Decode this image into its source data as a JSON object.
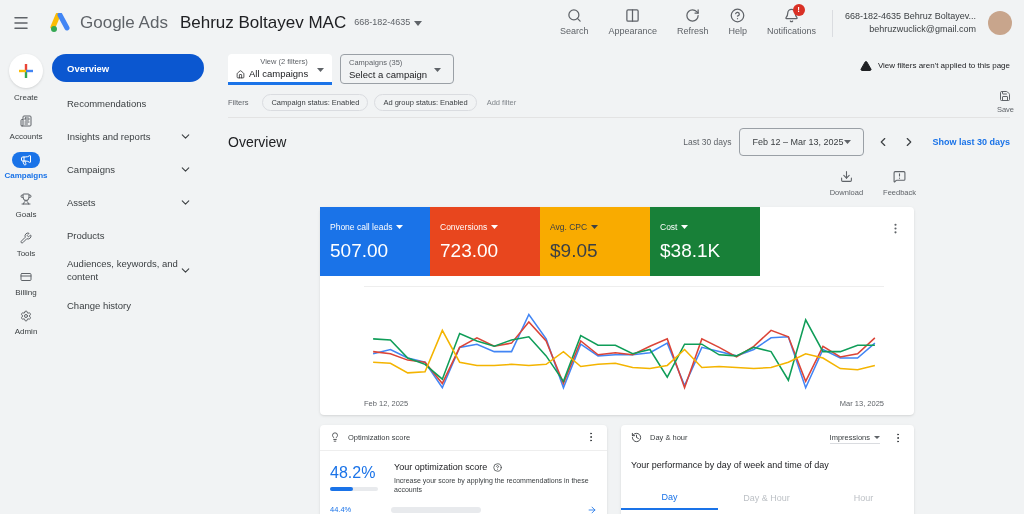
{
  "header": {
    "app_name": "Google Ads",
    "account": "Behruz Boltayev MAC",
    "account_id": "668-182-4635",
    "tools": [
      {
        "kind": "search",
        "label": "Search"
      },
      {
        "kind": "appearance",
        "label": "Appearance"
      },
      {
        "kind": "refresh",
        "label": "Refresh"
      },
      {
        "kind": "help",
        "label": "Help"
      },
      {
        "kind": "notifications",
        "label": "Notifications",
        "badge": "!"
      }
    ],
    "user_line": "668-182-4635 Behruz Boltayev...",
    "email": "behruzwuclick@gmail.com"
  },
  "rail": {
    "create": "Create",
    "items": [
      {
        "kind": "accounts",
        "label": "Accounts",
        "selected": false
      },
      {
        "kind": "campaigns",
        "label": "Campaigns",
        "selected": true
      },
      {
        "kind": "goals",
        "label": "Goals",
        "selected": false
      },
      {
        "kind": "tools",
        "label": "Tools",
        "selected": false
      },
      {
        "kind": "billing",
        "label": "Billing",
        "selected": false
      },
      {
        "kind": "admin",
        "label": "Admin",
        "selected": false
      }
    ]
  },
  "nav": [
    {
      "label": "Overview",
      "selected": true,
      "expandable": false
    },
    {
      "label": "Recommendations",
      "selected": false,
      "expandable": false
    },
    {
      "label": "Insights and reports",
      "selected": false,
      "expandable": true
    },
    {
      "label": "Campaigns",
      "selected": false,
      "expandable": true
    },
    {
      "label": "Assets",
      "selected": false,
      "expandable": true
    },
    {
      "label": "Products",
      "selected": false,
      "expandable": false
    },
    {
      "label": "Audiences, keywords, and content",
      "selected": false,
      "expandable": true
    },
    {
      "label": "Change history",
      "selected": false,
      "expandable": false
    }
  ],
  "view_select": {
    "caption": "View (2 filters)",
    "value": "All campaigns"
  },
  "campaign_select": {
    "caption": "Campaigns (35)",
    "value": "Select a campaign"
  },
  "filters": {
    "label": "Filters",
    "chips": [
      "Campaign status: Enabled",
      "Ad group status: Enabled"
    ],
    "add": "Add filter"
  },
  "warning": "View filters aren't applied to this page",
  "save": "Save",
  "overview": {
    "title": "Overview",
    "range_label": "Last 30 days",
    "date_range": "Feb 12 – Mar 13, 2025",
    "show_last": "Show last 30 days",
    "actions": [
      {
        "kind": "download",
        "label": "Download"
      },
      {
        "kind": "feedback",
        "label": "Feedback"
      }
    ]
  },
  "metrics": [
    {
      "label": "Phone call leads",
      "value": "507.00",
      "color": "#1a73e8"
    },
    {
      "label": "Conversions",
      "value": "723.00",
      "color": "#e8461e"
    },
    {
      "label": "Avg. CPC",
      "value": "$9.05",
      "color": "#f9ab00"
    },
    {
      "label": "Cost",
      "value": "$38.1K",
      "color": "#188038"
    }
  ],
  "chart": {
    "x_start": "Feb 12, 2025",
    "x_end": "Mar 13, 2025"
  },
  "optimization": {
    "title": "Optimization score",
    "score": "48.2%",
    "level": 0.48,
    "heading": "Your optimization score",
    "description": "Increase your score by applying the recommendations in these accounts",
    "account_score": "44.4%"
  },
  "day_hour": {
    "title": "Day & hour",
    "metric": "Impressions",
    "heading": "Your performance by day of week and time of day",
    "tabs": [
      {
        "label": "Day",
        "selected": true
      },
      {
        "label": "Day & Hour",
        "selected": false
      },
      {
        "label": "Hour",
        "selected": false
      }
    ]
  }
}
